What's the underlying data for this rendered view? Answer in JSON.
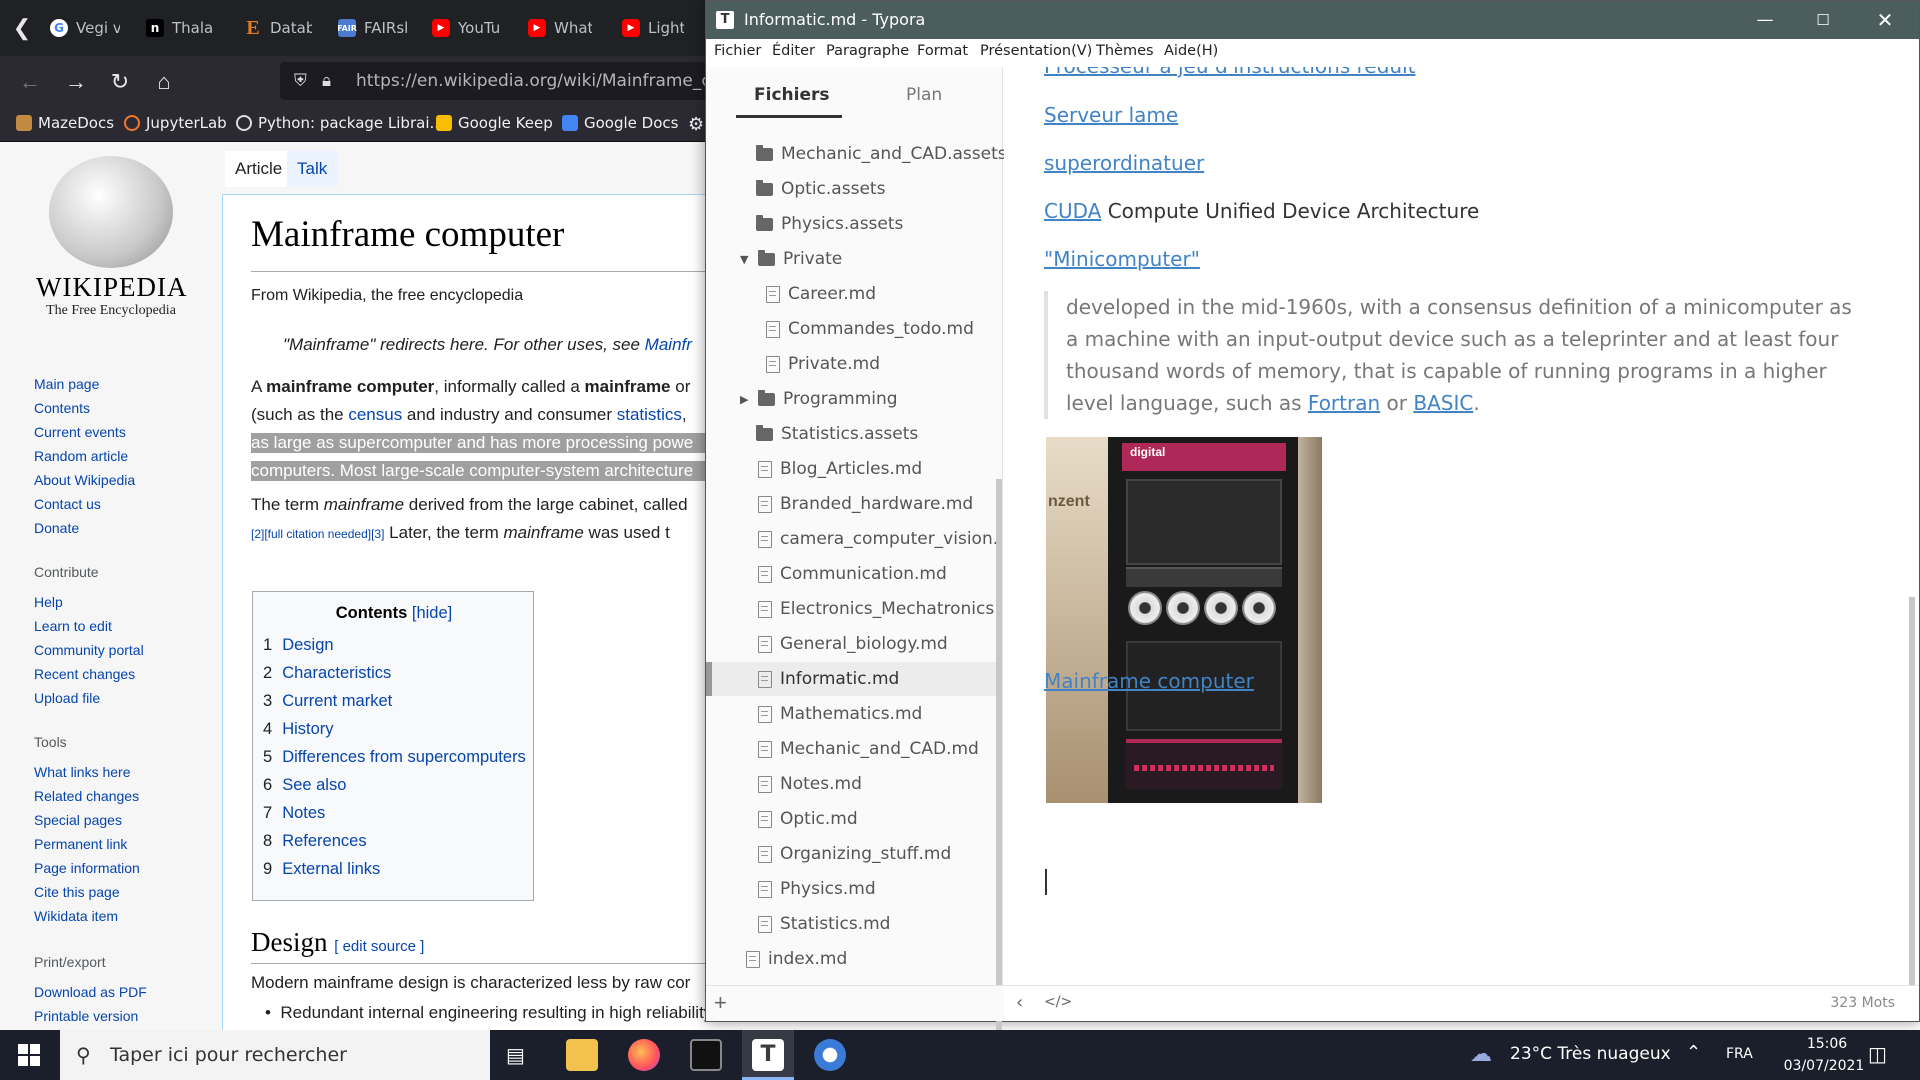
{
  "browser": {
    "tabs": [
      {
        "label": "Vegi v",
        "icon": "google-icon",
        "color": "#4285f4"
      },
      {
        "label": "Thala",
        "icon": "notion-icon",
        "color": "#ffffff"
      },
      {
        "label": "Datab",
        "icon": "e-icon",
        "color": "#e07b20"
      },
      {
        "label": "FAIRsl",
        "icon": "fair-icon",
        "color": "#4a7bd0"
      },
      {
        "label": "YouTu",
        "icon": "youtube-icon",
        "color": "#ff0000"
      },
      {
        "label": "What",
        "icon": "youtube-icon",
        "color": "#ff0000"
      },
      {
        "label": "Light",
        "icon": "youtube-icon",
        "color": "#ff0000"
      }
    ],
    "url": "https://en.wikipedia.org/wiki/Mainframe_com",
    "bookmarks": [
      {
        "label": "MazeDocs",
        "color": "#c08a40"
      },
      {
        "label": "JupyterLab",
        "color": "#f37726"
      },
      {
        "label": "Python: package Librai...",
        "color": "#dddddd"
      },
      {
        "label": "Google Keep",
        "color": "#fbbc04"
      },
      {
        "label": "Google Docs",
        "color": "#4285f4"
      }
    ]
  },
  "wiki": {
    "wordmark": "WIKIPEDIA",
    "tagline": "The Free Encyclopedia",
    "nav": [
      "Main page",
      "Contents",
      "Current events",
      "Random article",
      "About Wikipedia",
      "Contact us",
      "Donate"
    ],
    "contribute_heading": "Contribute",
    "contribute": [
      "Help",
      "Learn to edit",
      "Community portal",
      "Recent changes",
      "Upload file"
    ],
    "tools_heading": "Tools",
    "tools": [
      "What links here",
      "Related changes",
      "Special pages",
      "Permanent link",
      "Page information",
      "Cite this page",
      "Wikidata item"
    ],
    "print_heading": "Print/export",
    "print": [
      "Download as PDF",
      "Printable version"
    ],
    "tab_article": "Article",
    "tab_talk": "Talk",
    "title": "Mainframe computer",
    "from": "From Wikipedia, the free encyclopedia",
    "hatnote": "\"Mainframe\" redirects here. For other uses, see ",
    "hatnote_link": "Mainfr",
    "p1_a": "A ",
    "p1_b": "mainframe computer",
    "p1_c": ", informally called a ",
    "p1_d": "mainframe",
    "p1_e": " or",
    "p2_a": "(such as the ",
    "p2_b": "census",
    "p2_c": " and industry and consumer ",
    "p2_d": "statistics",
    "p2_e": ",",
    "p3": "as large as supercomputer and has more processing powe",
    "p4": "computers. Most large-scale computer-system architecture",
    "p5_a": "The term ",
    "p5_b": "mainframe",
    "p5_c": " derived from the large cabinet, called",
    "p6_cite": "[2][full citation needed][3]",
    "p6_a": " Later, the term ",
    "p6_b": "mainframe",
    "p6_c": " was used t",
    "toc_title": "Contents",
    "toc_hide": "[hide]",
    "toc": [
      {
        "num": "1",
        "label": "Design"
      },
      {
        "num": "2",
        "label": "Characteristics"
      },
      {
        "num": "3",
        "label": "Current market"
      },
      {
        "num": "4",
        "label": "History"
      },
      {
        "num": "5",
        "label": "Differences from supercomputers"
      },
      {
        "num": "6",
        "label": "See also"
      },
      {
        "num": "7",
        "label": "Notes"
      },
      {
        "num": "8",
        "label": "References"
      },
      {
        "num": "9",
        "label": "External links"
      }
    ],
    "design_heading": "Design",
    "edit_source": "[ edit source ]",
    "design_text": "Modern mainframe design is characterized less by raw cor",
    "bullet": "Redundant internal engineering resulting in high reliability and security"
  },
  "typora": {
    "title": "Informatic.md - Typora",
    "app_letter": "T",
    "menus": [
      "Fichier",
      "Éditer",
      "Paragraphe",
      "Format",
      "Présentation(V)",
      "Thèmes",
      "Aide(H)"
    ],
    "tab_files": "Fichiers",
    "tab_outline": "Plan",
    "files": [
      {
        "name": "Mechanic_and_CAD.assets",
        "type": "folder"
      },
      {
        "name": "Optic.assets",
        "type": "folder"
      },
      {
        "name": "Physics.assets",
        "type": "folder"
      },
      {
        "name": "Private",
        "type": "folder-open"
      },
      {
        "name": "Career.md",
        "type": "file"
      },
      {
        "name": "Commandes_todo.md",
        "type": "file"
      },
      {
        "name": "Private.md",
        "type": "file"
      },
      {
        "name": "Programming",
        "type": "folder-closed"
      },
      {
        "name": "Statistics.assets",
        "type": "folder"
      },
      {
        "name": "Blog_Articles.md",
        "type": "file"
      },
      {
        "name": "Branded_hardware.md",
        "type": "file"
      },
      {
        "name": "camera_computer_vision.md",
        "type": "file"
      },
      {
        "name": "Communication.md",
        "type": "file"
      },
      {
        "name": "Electronics_Mechatronics.md",
        "type": "file"
      },
      {
        "name": "General_biology.md",
        "type": "file"
      },
      {
        "name": "Informatic.md",
        "type": "file-active"
      },
      {
        "name": "Mathematics.md",
        "type": "file"
      },
      {
        "name": "Mechanic_and_CAD.md",
        "type": "file"
      },
      {
        "name": "Notes.md",
        "type": "file"
      },
      {
        "name": "Optic.md",
        "type": "file"
      },
      {
        "name": "Organizing_stuff.md",
        "type": "file"
      },
      {
        "name": "Physics.md",
        "type": "file"
      },
      {
        "name": "Statistics.md",
        "type": "file"
      },
      {
        "name": "index.md",
        "type": "file"
      }
    ],
    "doc": {
      "link1": "Processeur à jeu d'instructions réduit",
      "link2": "Serveur lame",
      "link3": "superordinatuer",
      "cuda_link": "CUDA",
      "cuda_text": " Compute Unified Device Architecture",
      "mini_link": "\"Minicomputer\"",
      "quote_a": "developed in the mid-1960s, with a consensus definition of a minicomputer as a machine with an input-output device such as a teleprinter and at least four thousand words of memory, that is capable of running programs in a  higher level language, such as ",
      "quote_fortran": "Fortran",
      "quote_or": " or ",
      "quote_basic": "BASIC",
      "quote_end": ".",
      "image_text": "digital",
      "image_side_text": "nzent",
      "mainframe_link": "Mainframe computer"
    },
    "word_count": "323 Mots"
  },
  "taskbar": {
    "search_placeholder": "Taper ici pour rechercher",
    "weather": "23°C  Très nuageux",
    "lang": "FRA",
    "time": "15:06",
    "date": "03/07/2021"
  }
}
